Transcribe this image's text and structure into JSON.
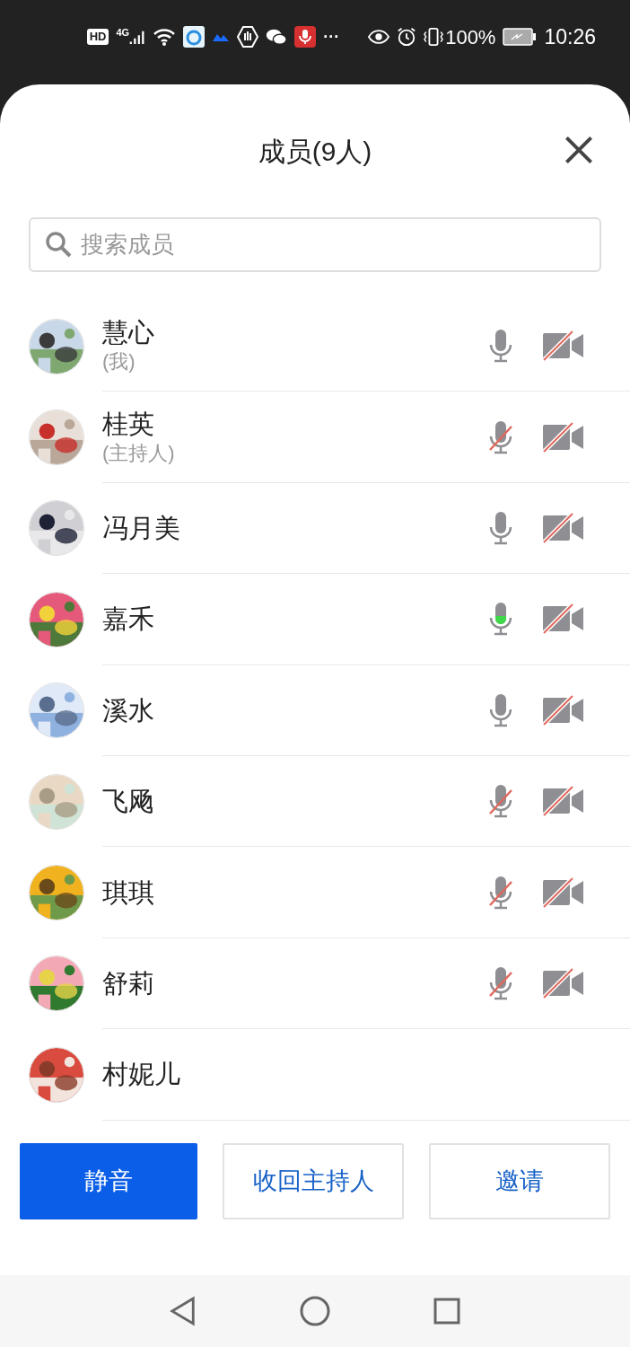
{
  "status_bar": {
    "hd": "HD",
    "network": "4G",
    "more": "···",
    "battery": "100%",
    "time": "10:26"
  },
  "sheet": {
    "title": "成员(9人)",
    "search": {
      "placeholder": "搜索成员"
    }
  },
  "members": [
    {
      "name": "慧心",
      "role": "(我)",
      "mic_muted": false,
      "speaking": false,
      "video_off": true
    },
    {
      "name": "桂英",
      "role": "(主持人)",
      "mic_muted": true,
      "speaking": false,
      "video_off": true
    },
    {
      "name": "冯月美",
      "mic_muted": false,
      "speaking": false,
      "video_off": true
    },
    {
      "name": "嘉禾",
      "mic_muted": false,
      "speaking": true,
      "video_off": true
    },
    {
      "name": "溪水",
      "mic_muted": false,
      "speaking": false,
      "video_off": true
    },
    {
      "name": "飞飏",
      "mic_muted": true,
      "speaking": false,
      "video_off": true
    },
    {
      "name": "琪琪",
      "mic_muted": true,
      "speaking": false,
      "video_off": true
    },
    {
      "name": "舒莉",
      "mic_muted": true,
      "speaking": false,
      "video_off": true
    },
    {
      "name": "村妮儿"
    }
  ],
  "buttons": [
    {
      "label": "静音",
      "primary": true
    },
    {
      "label": "收回主持人",
      "primary": false
    },
    {
      "label": "邀请",
      "primary": false
    }
  ]
}
